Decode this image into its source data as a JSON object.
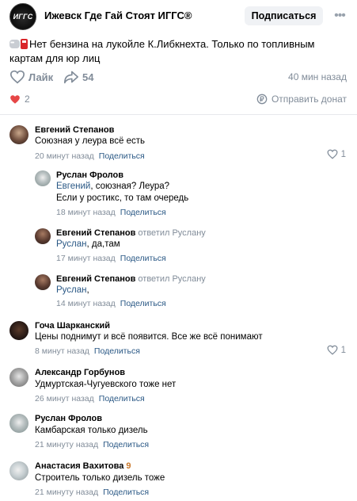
{
  "header": {
    "avatar_text": "ИГГС",
    "group_name": "Ижевск Где Гай Стоят ИГГС®",
    "subscribe_label": "Подписаться"
  },
  "post": {
    "text": "Нет бензина на лукойле К.Либкнехта. Только по топливным картам для юр лиц",
    "like_label": "Лайк",
    "share_count": "54",
    "time": "40 мин назад",
    "reaction_count": "2",
    "donate_label": "Отправить донат"
  },
  "comments": [
    {
      "author": "Евгений Степанов",
      "reply_to": "",
      "mention": "",
      "text": "Союзная у леура всё есть",
      "text2": "",
      "time": "20 минут назад",
      "share_label": "Поделиться",
      "likes": "1"
    },
    {
      "author": "Руслан Фролов",
      "reply_to": "",
      "mention": "Евгений",
      "text": ", союзная? Леура?",
      "text2": "Если у ростикс, то там очередь",
      "time": "18 минут назад",
      "share_label": "Поделиться"
    },
    {
      "author": "Евгений Степанов",
      "reply_to": "ответил Руслану",
      "mention": "Руслан",
      "text": ", да,там",
      "time": "17 минут назад",
      "share_label": "Поделиться"
    },
    {
      "author": "Евгений Степанов",
      "reply_to": "ответил Руслану",
      "mention": "Руслан",
      "text": ",",
      "time": "14 минут назад",
      "share_label": "Поделиться"
    },
    {
      "author": "Гоча Шарканский",
      "text": "Цены поднимут и всё появится. Все же всё понимают",
      "time": "8 минут назад",
      "share_label": "Поделиться",
      "likes": "1"
    },
    {
      "author": "Александр Горбунов",
      "text": "Удмуртская-Чугуевского тоже нет",
      "time": "26 минут назад",
      "share_label": "Поделиться"
    },
    {
      "author": "Руслан Фролов",
      "text": "Камбарская только дизель",
      "time": "21 минуту назад",
      "share_label": "Поделиться"
    },
    {
      "author": "Анастасия Вахитова",
      "author_emoji": "9",
      "text": "Строитель только дизель тоже",
      "time": "21 минуту назад",
      "share_label": "Поделиться"
    }
  ],
  "colors": {
    "accent_link": "#2a5885",
    "muted": "#818c99",
    "reaction_heart": "#e64646"
  },
  "icons": [
    "more-icon",
    "heart-outline-icon",
    "share-arrow-icon",
    "heart-filled-icon",
    "coin-icon",
    "heart-outline-icon"
  ]
}
